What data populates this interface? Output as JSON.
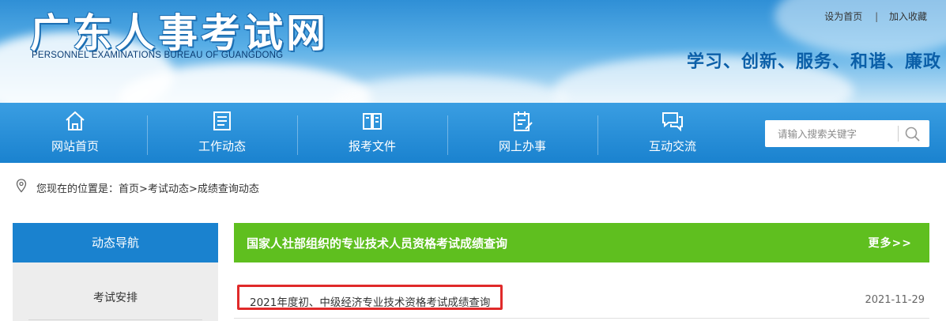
{
  "header": {
    "site_title": "广东人事考试网",
    "site_subtitle": "PERSONNEL EXAMINATIONS BUREAU OF GUANGDONG",
    "slogan": "学习、创新、服务、和谐、廉政",
    "top_links": [
      {
        "label": "设为首页"
      },
      {
        "label": "加入收藏"
      }
    ],
    "top_link_separator": "|"
  },
  "nav": {
    "items": [
      {
        "label": "网站首页",
        "icon": "home-icon"
      },
      {
        "label": "工作动态",
        "icon": "news-list-icon"
      },
      {
        "label": "报考文件",
        "icon": "document-icon"
      },
      {
        "label": "网上办事",
        "icon": "clipboard-edit-icon"
      },
      {
        "label": "互动交流",
        "icon": "chat-bubbles-icon"
      }
    ],
    "search": {
      "placeholder": "请输入搜索关键字",
      "icon": "search-icon"
    }
  },
  "breadcrumb": {
    "prefix": "您现在的位置是：",
    "items": [
      "首页",
      "考试动态",
      "成绩查询动态"
    ],
    "separator": ">",
    "icon": "location-pin-icon"
  },
  "sidebar": {
    "heading": "动态导航",
    "items": [
      {
        "label": "考试安排"
      }
    ]
  },
  "main": {
    "section_title": "国家人社部组织的专业技术人员资格考试成绩查询",
    "more_label": "更多>>",
    "items": [
      {
        "title": "2021年度初、中级经济专业技术资格考试成绩查询",
        "date": "2021-11-29"
      }
    ]
  },
  "colors": {
    "nav_blue": "#1a82cf",
    "section_green": "#5fbf1f",
    "highlight_red": "#e02a2a",
    "slogan_blue": "#0b5fa8"
  }
}
